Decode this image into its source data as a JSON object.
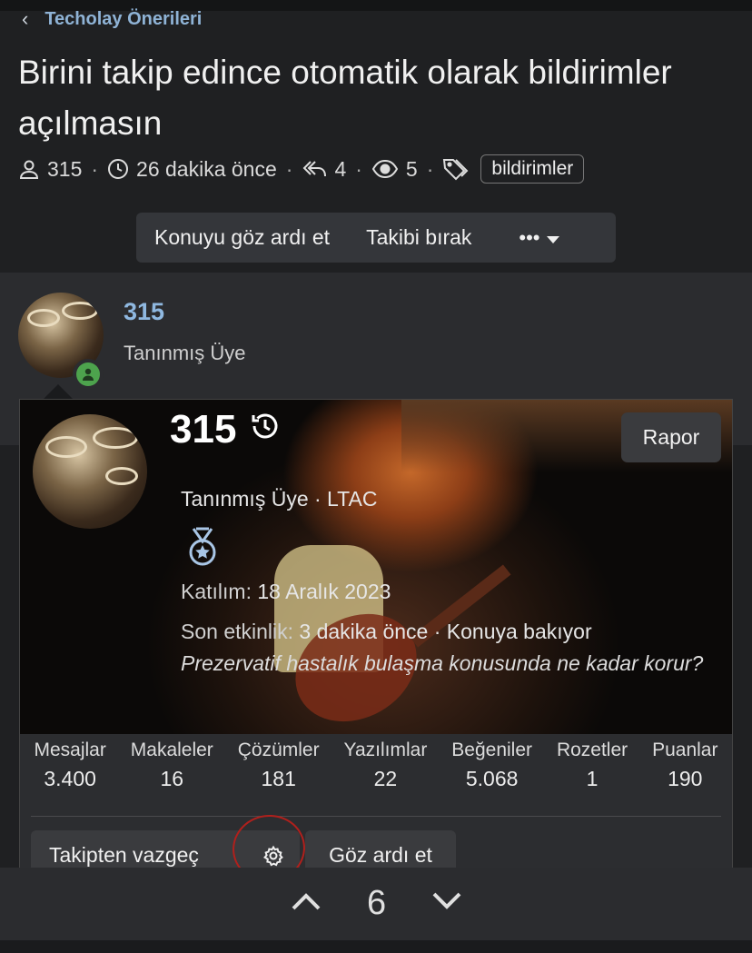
{
  "breadcrumb": {
    "label": "Techolay Önerileri"
  },
  "thread": {
    "title": "Birini takip edince otomatik olarak bildirimler açılmasın",
    "author": "315",
    "time": "26 dakika önce",
    "replies": "4",
    "views": "5",
    "tag": "bildirimler",
    "sep": "·"
  },
  "thread_actions": {
    "ignore": "Konuyu göz ardı et",
    "unwatch": "Takibi bırak",
    "more": "•••"
  },
  "post": {
    "username": "315",
    "user_title": "Tanınmış Üye"
  },
  "member_card": {
    "name": "315",
    "report": "Rapor",
    "title_line": "Tanınmış Üye · LTAC",
    "joined_label": "Katılım:",
    "joined_value": "18 Aralık 2023",
    "last_activity_label": "Son etkinlik:",
    "last_activity_value": "3 dakika önce · Konuya bakıyor",
    "activity_detail": "Prezervatif hastalık bulaşma konusunda ne kadar korur?",
    "stats": [
      {
        "label": "Mesajlar",
        "value": "3.400"
      },
      {
        "label": "Makaleler",
        "value": "16"
      },
      {
        "label": "Çözümler",
        "value": "181"
      },
      {
        "label": "Yazılımlar",
        "value": "22"
      },
      {
        "label": "Beğeniler",
        "value": "5.068"
      },
      {
        "label": "Rozetler",
        "value": "1"
      },
      {
        "label": "Puanlar",
        "value": "190"
      }
    ],
    "unfollow": "Takipten vazgeç",
    "ignore": "Göz ardı et"
  },
  "pager": {
    "page": "6"
  },
  "colors": {
    "accent": "#8fb8e0",
    "annotation": "#b0201c",
    "online": "#4da34d"
  }
}
